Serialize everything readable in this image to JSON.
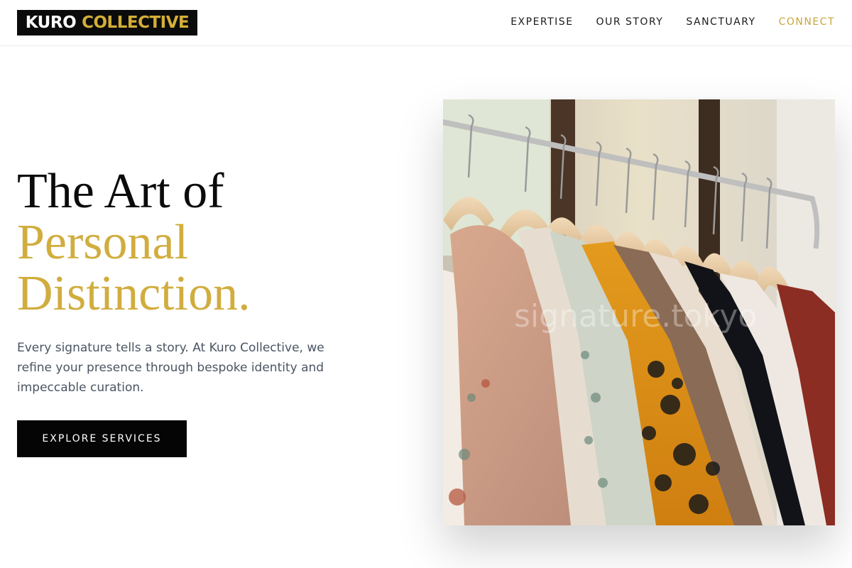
{
  "brand": {
    "name_part1": "KURO",
    "name_part2": "COLLECTIVE",
    "accent_color": "#d4af37"
  },
  "nav": {
    "items": [
      {
        "label": "EXPERTISE"
      },
      {
        "label": "OUR STORY"
      },
      {
        "label": "SANCTUARY"
      },
      {
        "label": "CONNECT"
      }
    ]
  },
  "hero": {
    "headline_line1": "The Art of",
    "headline_line2": "Personal",
    "headline_line3": "Distinction.",
    "description": "Every signature tells a story. At Kuro Collective, we refine your presence through bespoke identity and impeccable curation.",
    "cta_label": "EXPLORE SERVICES"
  },
  "image": {
    "subject": "clothing rack with shirts on wooden hangers",
    "watermark": "signature.tokyo"
  }
}
